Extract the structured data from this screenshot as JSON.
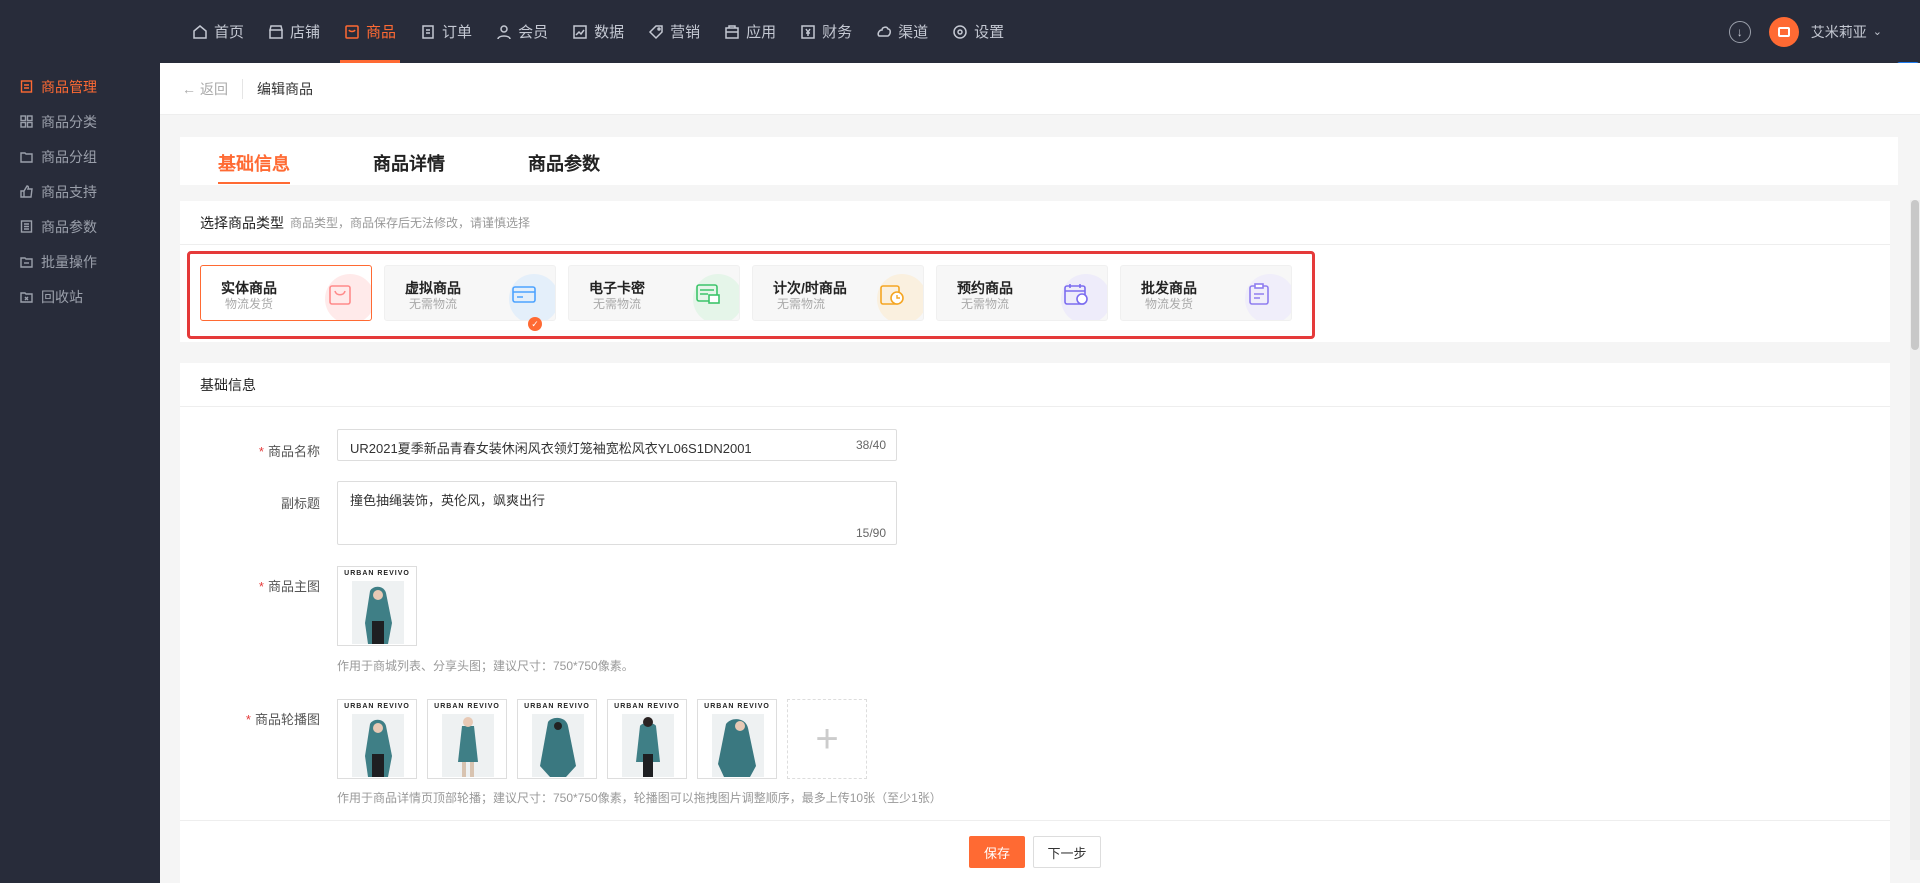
{
  "nav": {
    "items": [
      {
        "label": "首页",
        "icon": "home-icon"
      },
      {
        "label": "店铺",
        "icon": "store-icon"
      },
      {
        "label": "商品",
        "icon": "goods-icon",
        "active": true
      },
      {
        "label": "订单",
        "icon": "order-icon"
      },
      {
        "label": "会员",
        "icon": "member-icon"
      },
      {
        "label": "数据",
        "icon": "chart-icon"
      },
      {
        "label": "营销",
        "icon": "tag-icon"
      },
      {
        "label": "应用",
        "icon": "app-icon"
      },
      {
        "label": "财务",
        "icon": "finance-icon"
      },
      {
        "label": "渠道",
        "icon": "channel-icon"
      },
      {
        "label": "设置",
        "icon": "gear-icon"
      }
    ],
    "username": "艾米莉亚",
    "accent": "#ff6a33"
  },
  "sidebar": {
    "items": [
      {
        "label": "商品管理",
        "active": true
      },
      {
        "label": "商品分类"
      },
      {
        "label": "商品分组"
      },
      {
        "label": "商品支持"
      },
      {
        "label": "商品参数"
      },
      {
        "label": "批量操作"
      },
      {
        "label": "回收站"
      }
    ]
  },
  "breadcrumb": {
    "back": "返回",
    "current": "编辑商品"
  },
  "tabs": [
    {
      "label": "基础信息",
      "active": true
    },
    {
      "label": "商品详情"
    },
    {
      "label": "商品参数"
    }
  ],
  "type_section": {
    "title": "选择商品类型",
    "hint": "商品类型，商品保存后无法修改，请谨慎选择",
    "types": [
      {
        "name": "实体商品",
        "sub": "物流发货",
        "selected": true,
        "color": "#ff7a7a"
      },
      {
        "name": "虚拟商品",
        "sub": "无需物流",
        "color": "#4da3ff"
      },
      {
        "name": "电子卡密",
        "sub": "无需物流",
        "color": "#3cc46a"
      },
      {
        "name": "计次/时商品",
        "sub": "无需物流",
        "color": "#f5a623"
      },
      {
        "name": "预约商品",
        "sub": "无需物流",
        "color": "#7b6cf0"
      },
      {
        "name": "批发商品",
        "sub": "物流发货",
        "color": "#8f7ef0"
      }
    ]
  },
  "basic": {
    "title": "基础信息",
    "name_label": "商品名称",
    "name_value": "UR2021夏季新品青春女装休闲风衣领灯笼袖宽松风衣YL06S1DN2001",
    "name_count": "38/40",
    "subtitle_label": "副标题",
    "subtitle_value": "撞色抽绳装饰，英伦风，飒爽出行",
    "subtitle_count": "15/90",
    "main_image_label": "商品主图",
    "main_image_help": "作用于商城列表、分享头图；建议尺寸：750*750像素。",
    "carousel_label": "商品轮播图",
    "carousel_help": "作用于商品详情页顶部轮播；建议尺寸：750*750像素，轮播图可以拖拽图片调整顺序，最多上传10张（至少1张）",
    "brand": "URBAN REVIVO"
  },
  "footer": {
    "save": "保存",
    "next": "下一步"
  }
}
